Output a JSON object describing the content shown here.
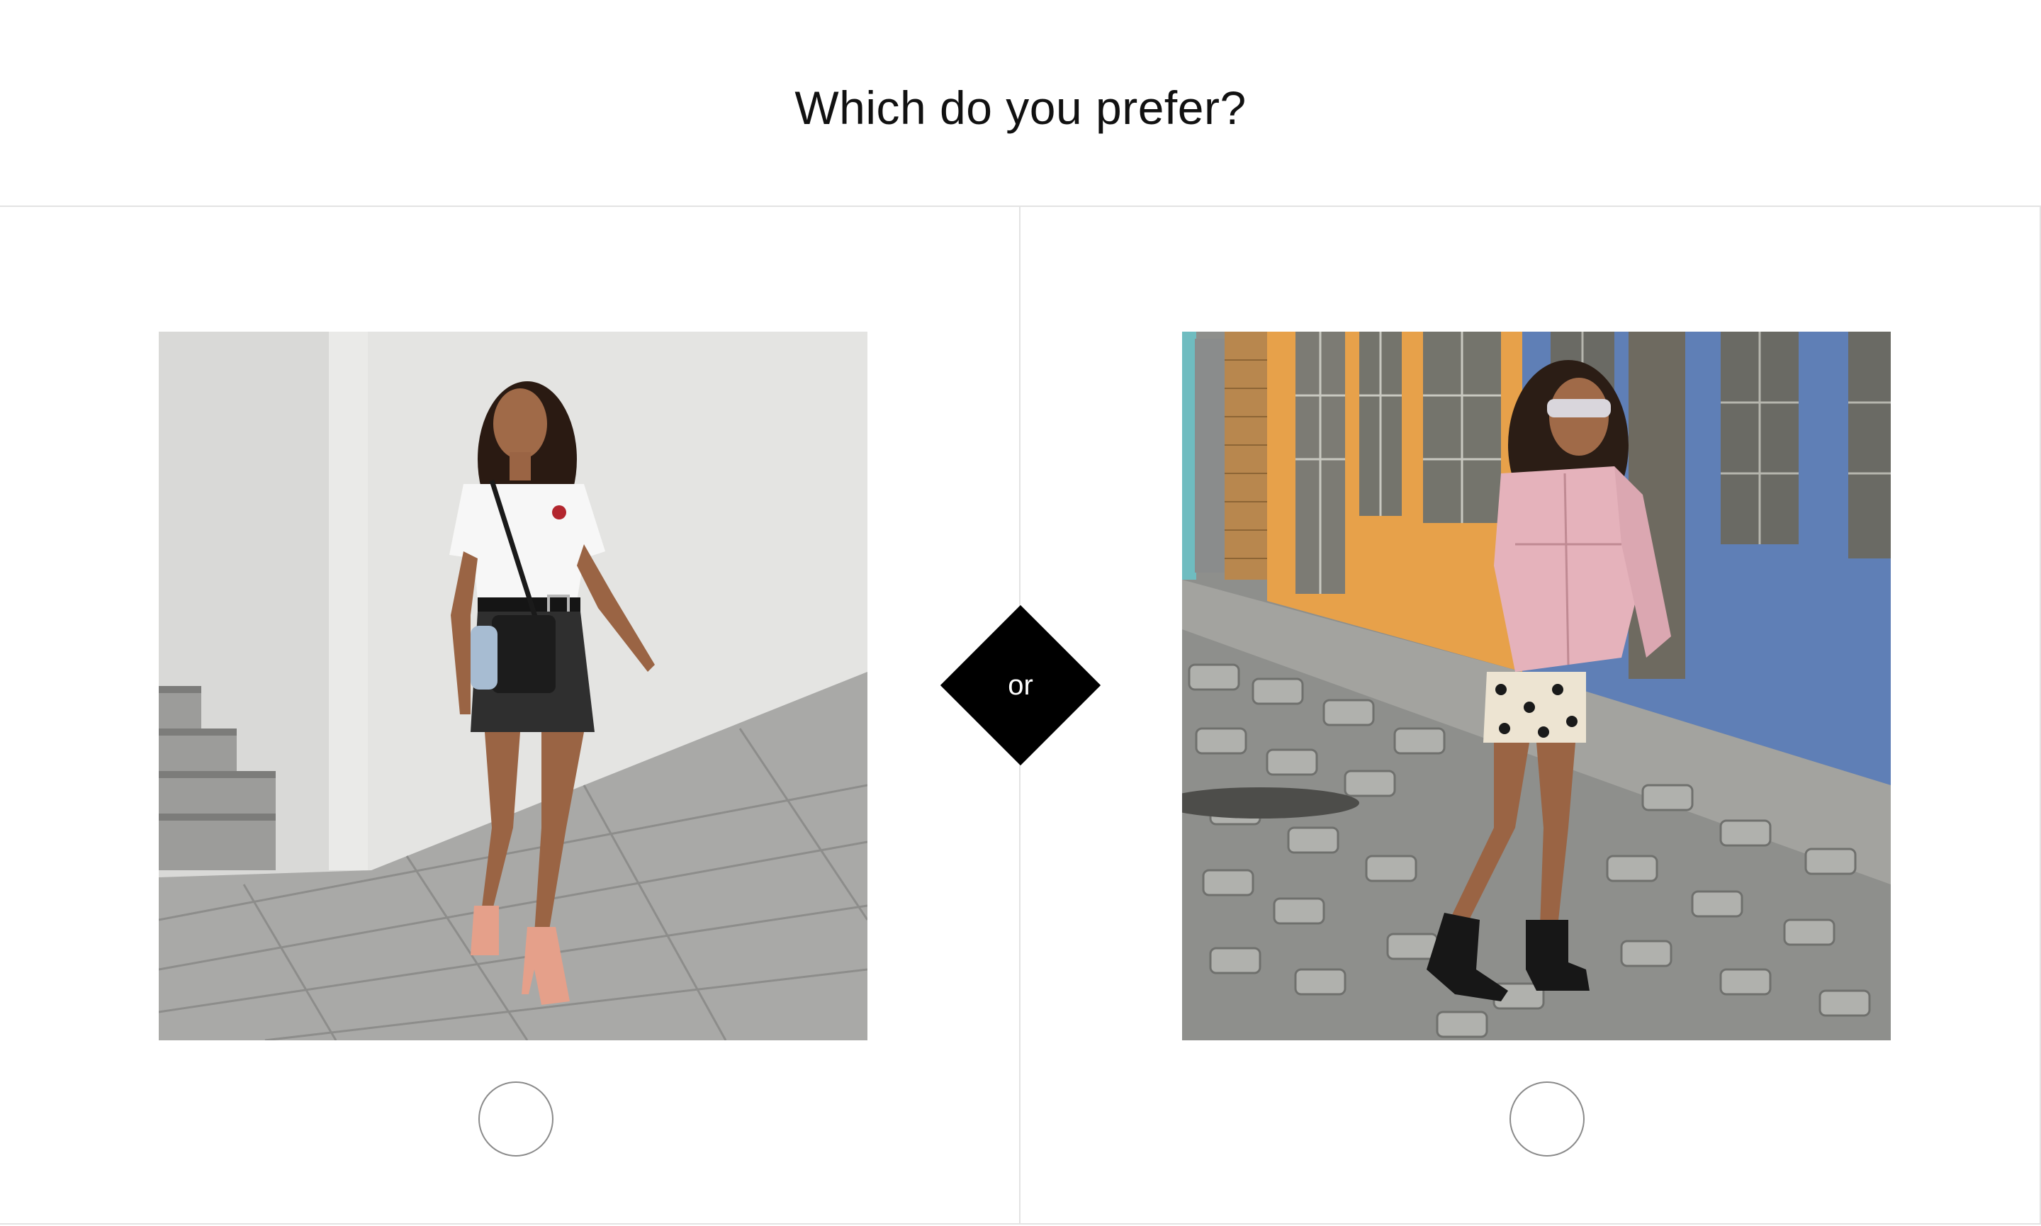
{
  "survey": {
    "question": "Which do you prefer?",
    "separator_label": "or"
  },
  "options": [
    {
      "image": "woman in white t-shirt, black denim mini skirt, crossbody bag and pink heeled sandals by a white wall",
      "selected": false
    },
    {
      "image": "woman in pink denim jacket, polka dot skirt, mirrored sunglasses and black studded cut-out boots on a cobblestone street with colorful buildings",
      "selected": false
    }
  ],
  "colors": {
    "background": "#ffffff",
    "divider": "#e3e3e3",
    "badge": "#000000",
    "radio_border": "#8a8a8a"
  }
}
